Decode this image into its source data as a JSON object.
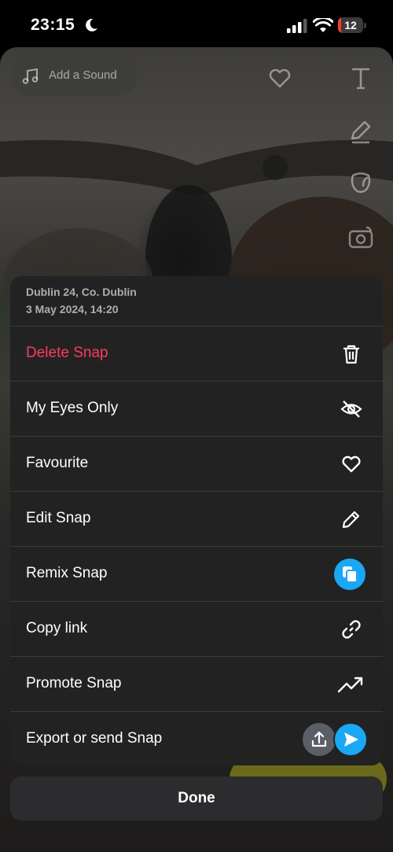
{
  "status_bar": {
    "time": "23:15",
    "battery": "12",
    "battery_level": 0.12
  },
  "photo": {
    "sound_label": "Add a Sound",
    "tools": [
      "text-tool",
      "pen-tool",
      "sticker-tool",
      "camera-switch"
    ]
  },
  "sheet": {
    "location": "Dublin 24, Co. Dublin",
    "datetime": "3 May 2024, 14:20",
    "items": [
      {
        "label": "Delete Snap",
        "icon": "trash-icon",
        "color": "#ff3b5c"
      },
      {
        "label": "My Eyes Only",
        "icon": "eye-slash-icon"
      },
      {
        "label": "Favourite",
        "icon": "heart-icon"
      },
      {
        "label": "Edit Snap",
        "icon": "pencil-icon"
      },
      {
        "label": "Remix Snap",
        "icon": "remix-icon"
      },
      {
        "label": "Copy link",
        "icon": "link-icon"
      },
      {
        "label": "Promote Snap",
        "icon": "trend-up-icon"
      },
      {
        "label": "Export or send Snap",
        "icon": "upload-icon"
      }
    ]
  },
  "done_label": "Done",
  "colors": {
    "accent_blue": "#1aa8f5",
    "danger": "#ff3b5c",
    "sheet_bg": "#222223"
  }
}
